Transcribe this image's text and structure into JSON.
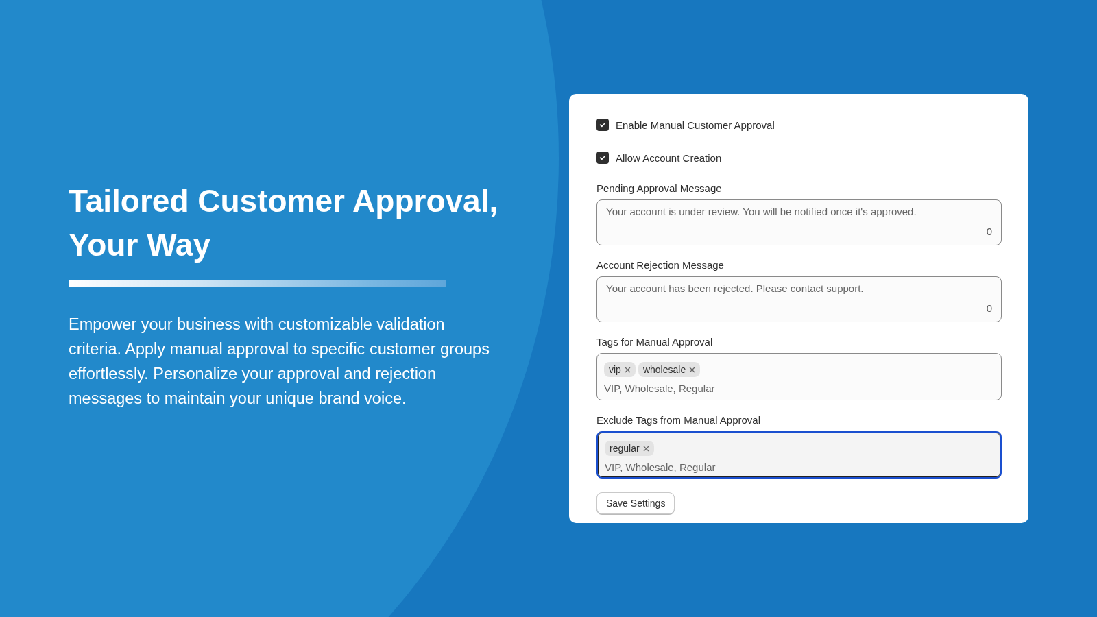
{
  "hero": {
    "title": "Tailored Customer Approval, Your Way",
    "description": "Empower your business with customizable validation criteria. Apply manual approval to specific customer groups effortlessly. Personalize your approval and rejection messages to maintain your unique brand voice."
  },
  "settings": {
    "checkboxes": [
      {
        "label": "Enable Manual Customer Approval",
        "checked": true
      },
      {
        "label": "Allow Account Creation",
        "checked": true
      }
    ],
    "messages": [
      {
        "label": "Pending Approval Message",
        "placeholder": "Your account is under review. You will be notified once it's approved.",
        "count": "0"
      },
      {
        "label": "Account Rejection Message",
        "placeholder": "Your account has been rejected. Please contact support.",
        "count": "0"
      }
    ],
    "tag_fields": [
      {
        "label": "Tags for Manual Approval",
        "tags": [
          "vip",
          "wholesale"
        ],
        "placeholder": "VIP, Wholesale, Regular",
        "focused": false
      },
      {
        "label": "Exclude Tags from Manual Approval",
        "tags": [
          "regular"
        ],
        "placeholder": "VIP, Wholesale, Regular",
        "focused": true
      }
    ],
    "save_button": "Save Settings"
  }
}
